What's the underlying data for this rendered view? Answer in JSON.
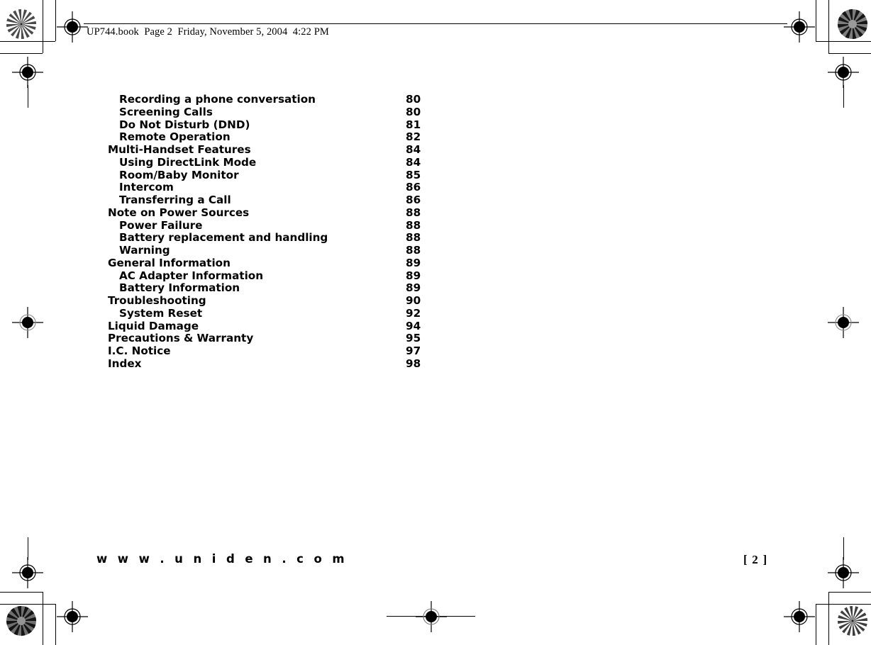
{
  "header": {
    "file_info": "UP744.book  Page 2  Friday, November 5, 2004  4:22 PM"
  },
  "toc": {
    "entries": [
      {
        "label": "Recording a phone conversation",
        "page": "80",
        "level": 2
      },
      {
        "label": "Screening Calls",
        "page": "80",
        "level": 2
      },
      {
        "label": "Do Not Disturb (DND)",
        "page": "81",
        "level": 2
      },
      {
        "label": "Remote Operation",
        "page": "82",
        "level": 2
      },
      {
        "label": "Multi-Handset Features",
        "page": "84",
        "level": 1
      },
      {
        "label": "Using DirectLink Mode",
        "page": "84",
        "level": 2
      },
      {
        "label": "Room/Baby Monitor",
        "page": "85",
        "level": 2
      },
      {
        "label": "Intercom",
        "page": "86",
        "level": 2
      },
      {
        "label": "Transferring a Call",
        "page": "86",
        "level": 2
      },
      {
        "label": "Note on Power Sources",
        "page": "88",
        "level": 1
      },
      {
        "label": "Power Failure",
        "page": "88",
        "level": 2
      },
      {
        "label": "Battery replacement and handling",
        "page": "88",
        "level": 2
      },
      {
        "label": "Warning",
        "page": "88",
        "level": 2
      },
      {
        "label": "General Information",
        "page": "89",
        "level": 1
      },
      {
        "label": "AC Adapter Information",
        "page": "89",
        "level": 2
      },
      {
        "label": "Battery Information",
        "page": "89",
        "level": 2
      },
      {
        "label": "Troubleshooting",
        "page": "90",
        "level": 1
      },
      {
        "label": "System Reset",
        "page": "92",
        "level": 2
      },
      {
        "label": "Liquid Damage",
        "page": "94",
        "level": 1
      },
      {
        "label": "Precautions & Warranty",
        "page": "95",
        "level": 1
      },
      {
        "label": "I.C. Notice",
        "page": "97",
        "level": 1
      },
      {
        "label": "Index",
        "page": "98",
        "level": 1
      }
    ]
  },
  "footer": {
    "website": "w w w . u n i d e n . c o m",
    "page_number": "[ 2 ]"
  },
  "colors": {
    "ink": "#000000",
    "paper": "#ffffff"
  }
}
